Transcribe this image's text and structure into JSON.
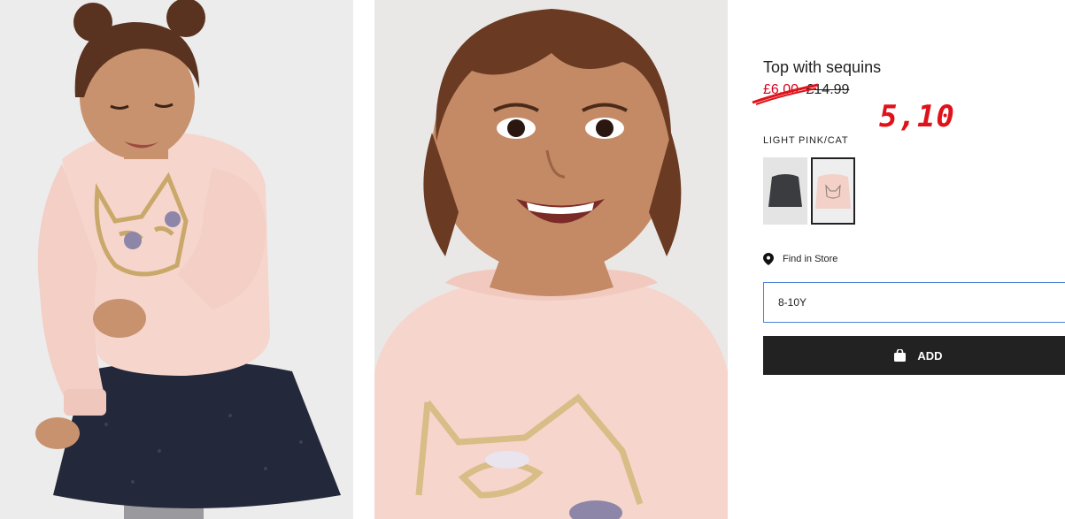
{
  "gallery": {
    "image1": {
      "alt": "girl-wearing-sequin-top-and-tulle-skirt"
    },
    "image2": {
      "alt": "close-up-smiling-girl-sequin-cat-top"
    }
  },
  "product": {
    "title": "Top with sequins",
    "sale_price": "£6.00",
    "original_price": "£14.99",
    "annotation": "5,10",
    "color_label": "LIGHT PINK/CAT",
    "swatches": [
      {
        "name": "dark-grey",
        "selected": false
      },
      {
        "name": "light-pink-cat",
        "selected": true
      }
    ],
    "find_in_store": "Find in Store",
    "size_value": "8-10Y",
    "add_label": "ADD"
  },
  "colors": {
    "sale": "#d6001c",
    "annotation": "#e01219",
    "button_bg": "#222222",
    "select_border": "#4a82d8",
    "top_pink": "#f6d5cc",
    "tutu_navy": "#23283a"
  },
  "icons": {
    "location": "map-pin-icon",
    "bag": "shopping-bag-icon"
  }
}
